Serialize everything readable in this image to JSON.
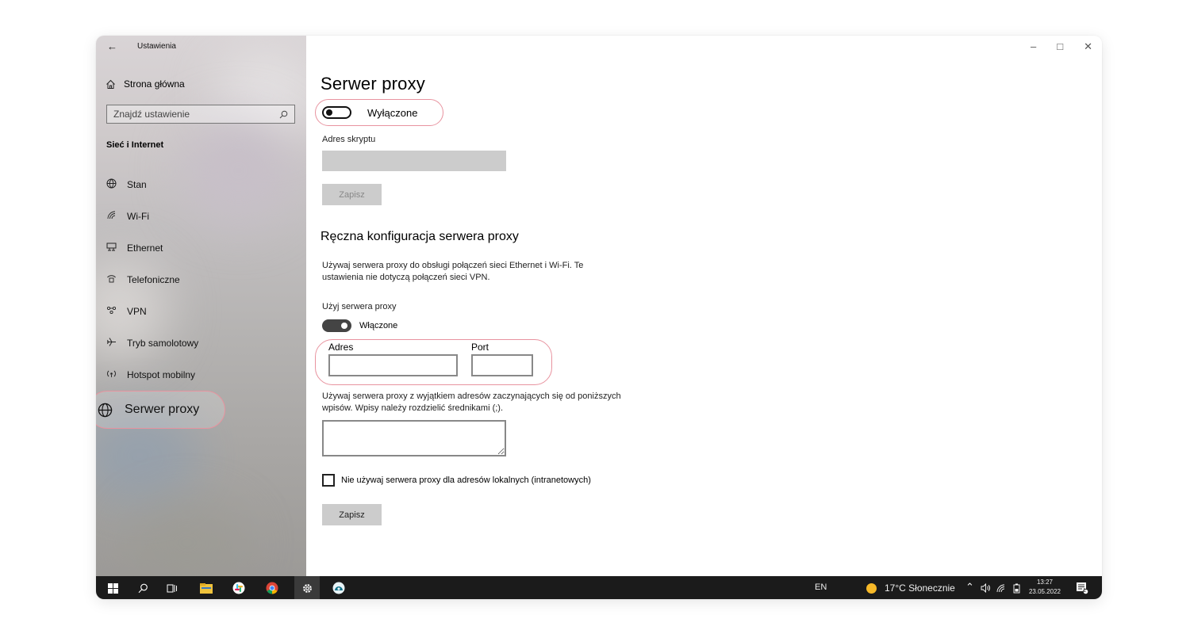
{
  "window": {
    "title": "Ustawienia",
    "back_glyph": "←",
    "controls": {
      "minimize": "–",
      "maximize": "□",
      "close": "✕"
    }
  },
  "sidebar": {
    "home_label": "Strona główna",
    "search_placeholder": "Znajdź ustawienie",
    "category": "Sieć i Internet",
    "items": [
      {
        "label": "Stan",
        "icon": "globe-outline-icon"
      },
      {
        "label": "Wi-Fi",
        "icon": "wifi-icon"
      },
      {
        "label": "Ethernet",
        "icon": "ethernet-icon"
      },
      {
        "label": "Telefoniczne",
        "icon": "dialup-icon"
      },
      {
        "label": "VPN",
        "icon": "vpn-icon"
      },
      {
        "label": "Tryb samolotowy",
        "icon": "airplane-icon"
      },
      {
        "label": "Hotspot mobilny",
        "icon": "hotspot-icon"
      }
    ],
    "active_item": "Serwer proxy"
  },
  "main": {
    "title": "Serwer proxy",
    "auto": {
      "toggle_state": "Wyłączone",
      "script_label": "Adres skryptu",
      "script_value": "",
      "save_label": "Zapisz"
    },
    "manual": {
      "section_title": "Ręczna konfiguracja serwera proxy",
      "description": "Używaj serwera proxy do obsługi połączeń sieci Ethernet i Wi-Fi. Te ustawienia nie dotyczą połączeń sieci VPN.",
      "use_proxy_label": "Użyj serwera proxy",
      "toggle_state": "Włączone",
      "address_label": "Adres",
      "address_value": "",
      "port_label": "Port",
      "port_value": "",
      "exceptions_description": "Używaj serwera proxy z wyjątkiem adresów zaczynających się od poniższych wpisów. Wpisy należy rozdzielić średnikami (;).",
      "exceptions_value": "",
      "local_checkbox_label": "Nie używaj serwera proxy dla adresów lokalnych (intranetowych)",
      "local_checkbox_checked": false,
      "save_label": "Zapisz"
    }
  },
  "taskbar": {
    "language": "EN",
    "weather": "17°C  Słonecznie",
    "time": "13:27",
    "date": "23.05.2022",
    "notification_count": "1"
  },
  "colors": {
    "highlight_outline": "#e8939f",
    "taskbar": "#1b1b1b",
    "button_bg": "#cccccc"
  }
}
